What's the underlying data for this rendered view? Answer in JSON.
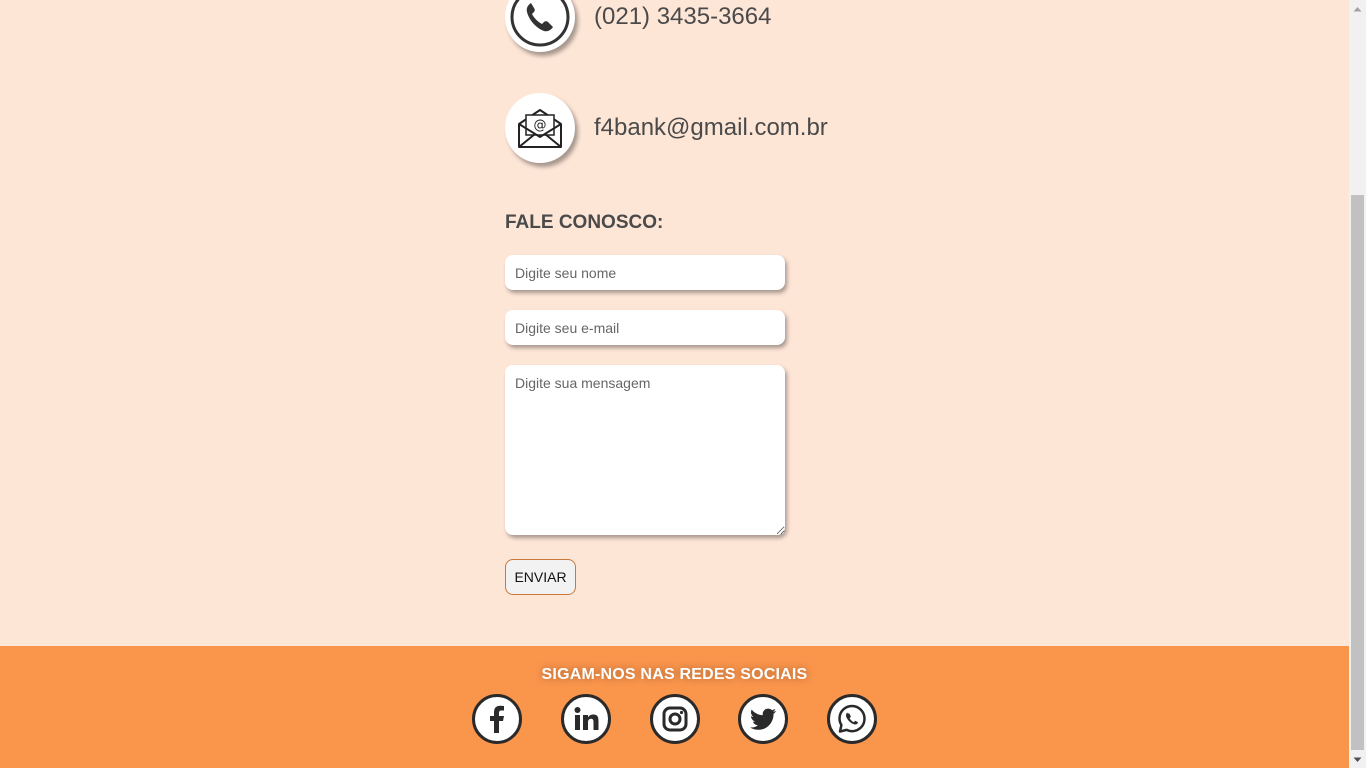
{
  "contact": {
    "phone": "(021) 3435-3664",
    "phone_icon": "phone-icon",
    "email": "f4bank@gmail.com.br",
    "email_icon": "envelope-icon"
  },
  "form": {
    "title": "FALE CONOSCO:",
    "name_placeholder": "Digite seu nome",
    "email_placeholder": "Digite seu e-mail",
    "message_placeholder": "Digite sua mensagem",
    "submit_label": "ENVIAR"
  },
  "footer": {
    "title": "SIGAM-NOS NAS REDES SOCIAIS",
    "social": [
      "facebook-icon",
      "linkedin-icon",
      "instagram-icon",
      "twitter-icon",
      "whatsapp-icon"
    ]
  },
  "colors": {
    "background": "#fee6d7",
    "footer": "#fa954c",
    "text": "#4a4a4a",
    "button_border": "#c9793a"
  }
}
